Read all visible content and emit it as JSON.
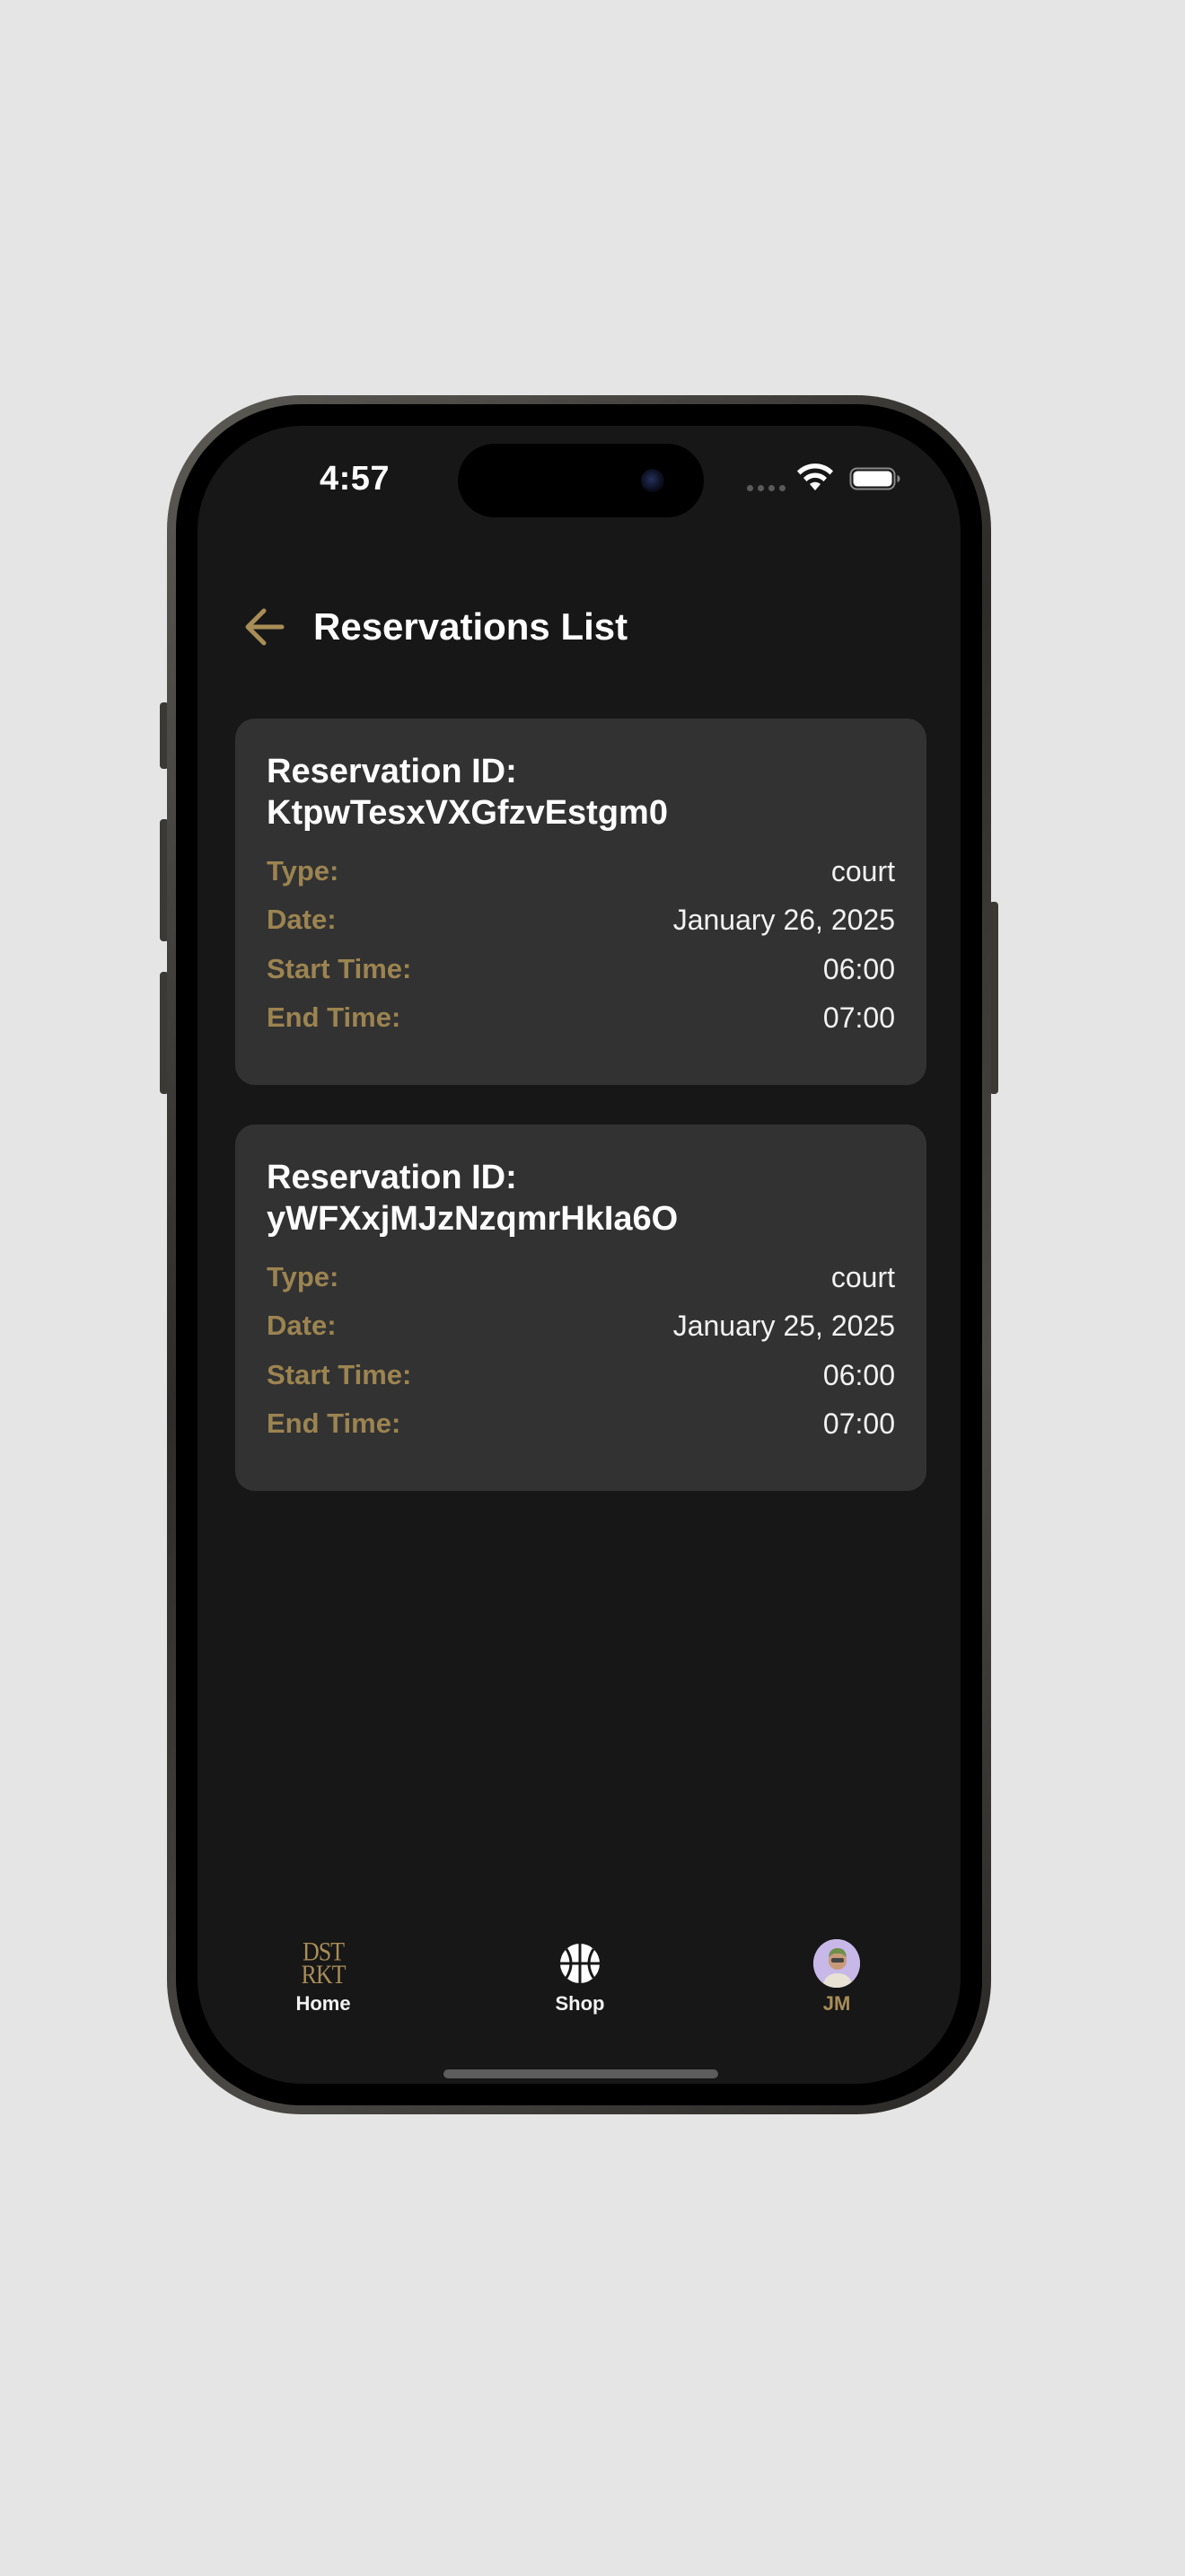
{
  "status_bar": {
    "time": "4:57"
  },
  "header": {
    "title": "Reservations List",
    "back_icon": "arrow-left-icon"
  },
  "reservations": [
    {
      "id_label": "Reservation ID:",
      "id": "KtpwTesxVXGfzvEstgm0",
      "rows": [
        {
          "label": "Type:",
          "value": "court"
        },
        {
          "label": "Date:",
          "value": "January 26, 2025"
        },
        {
          "label": "Start Time:",
          "value": "06:00"
        },
        {
          "label": "End Time:",
          "value": "07:00"
        }
      ]
    },
    {
      "id_label": "Reservation ID:",
      "id": "yWFXxjMJzNzqmrHkIa6O",
      "rows": [
        {
          "label": "Type:",
          "value": "court"
        },
        {
          "label": "Date:",
          "value": "January 25, 2025"
        },
        {
          "label": "Start Time:",
          "value": "06:00"
        },
        {
          "label": "End Time:",
          "value": "07:00"
        }
      ]
    }
  ],
  "tab_bar": {
    "items": [
      {
        "label": "Home",
        "icon": "dstrkt-logo-icon",
        "active": false
      },
      {
        "label": "Shop",
        "icon": "basketball-icon",
        "active": false
      },
      {
        "label": "JM",
        "icon": "avatar",
        "active": true
      }
    ]
  },
  "colors": {
    "background": "#171717",
    "card": "#323232",
    "accent": "#a88d57",
    "label": "#9c8451",
    "text": "#ffffff"
  }
}
